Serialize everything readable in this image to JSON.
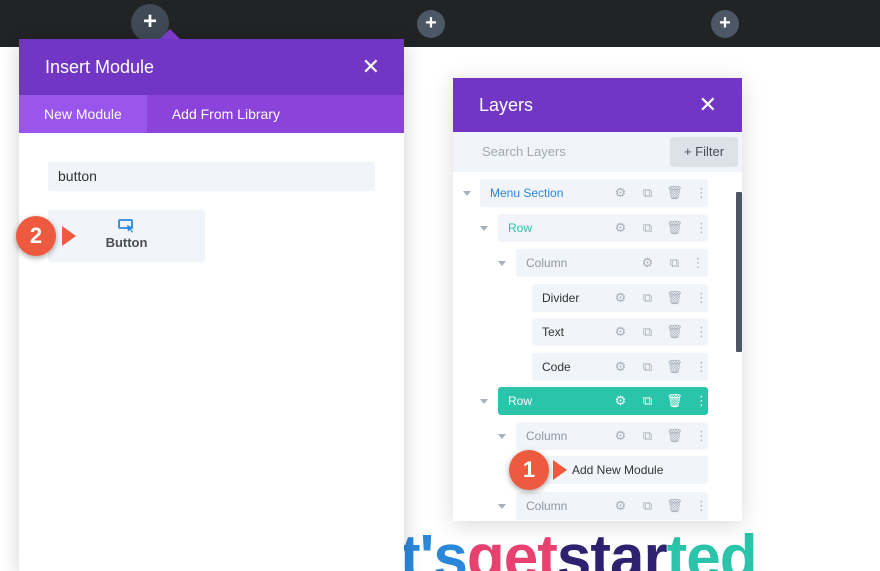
{
  "topbar": {
    "add_symbol": "+"
  },
  "insert_module": {
    "title": "Insert Module",
    "close_symbol": "✕",
    "tabs": [
      {
        "label": "New Module",
        "active": true
      },
      {
        "label": "Add From Library",
        "active": false
      }
    ],
    "search_value": "button",
    "modules": [
      {
        "label": "Button",
        "icon": "cursor-click-icon"
      }
    ]
  },
  "layers": {
    "title": "Layers",
    "close_symbol": "✕",
    "search_placeholder": "Search Layers",
    "filter_label": "+ Filter",
    "items": [
      {
        "label": "Menu Section",
        "type": "section"
      },
      {
        "label": "Row",
        "type": "row"
      },
      {
        "label": "Column",
        "type": "column"
      },
      {
        "label": "Divider",
        "type": "module"
      },
      {
        "label": "Text",
        "type": "module"
      },
      {
        "label": "Code",
        "type": "module"
      },
      {
        "label": "Row",
        "type": "row",
        "active": true
      },
      {
        "label": "Column",
        "type": "column"
      },
      {
        "label": "Add New Module",
        "type": "add"
      },
      {
        "label": "Column",
        "type": "column"
      }
    ]
  },
  "steps": [
    {
      "number": "1"
    },
    {
      "number": "2"
    }
  ],
  "headline": {
    "parts": [
      {
        "text": "t's ",
        "color": "#2b87da"
      },
      {
        "text": "get ",
        "color": "#e8416f"
      },
      {
        "text": "star",
        "color": "#2d2170"
      },
      {
        "text": "ted",
        "color": "#29c4a9"
      }
    ]
  },
  "colors": {
    "purple_header": "#7236c5",
    "purple_tabs": "#8c43dc",
    "teal": "#29c4a9",
    "blue": "#2b87da",
    "badge_red": "#ee5a3f"
  }
}
